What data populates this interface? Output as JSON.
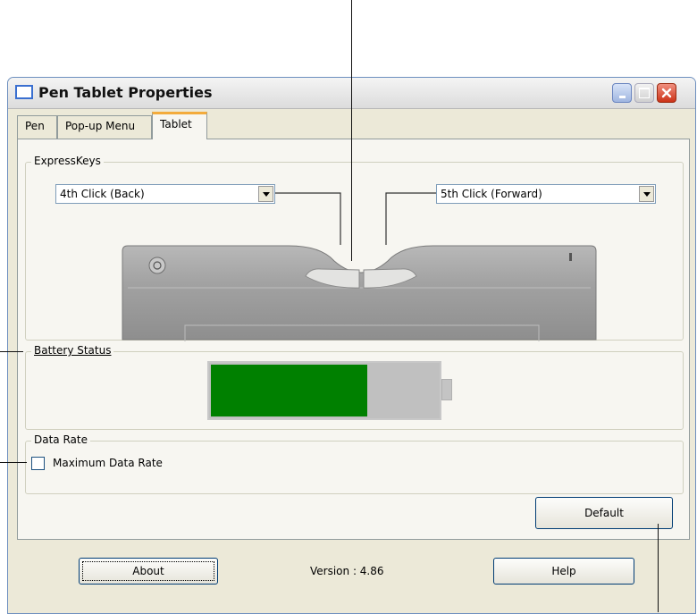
{
  "window": {
    "title": "Pen Tablet Properties",
    "tabs": [
      {
        "label": "Pen"
      },
      {
        "label": "Pop-up Menu"
      },
      {
        "label": "Tablet"
      }
    ],
    "active_tab": "Tablet"
  },
  "express_keys": {
    "legend": "ExpressKeys",
    "left_select": "4th Click (Back)",
    "right_select": "5th Click (Forward)"
  },
  "battery": {
    "legend": "Battery Status",
    "level": 0.68,
    "fill_color": "#008000",
    "empty_color": "#c0c0c0"
  },
  "data_rate": {
    "legend": "Data Rate",
    "checkbox_label": "Maximum Data Rate",
    "checked": false
  },
  "buttons": {
    "default": "Default",
    "about": "About",
    "help": "Help"
  },
  "version": "Version : 4.86",
  "icons": [
    "window-icon",
    "minimize-icon",
    "maximize-icon",
    "close-icon",
    "dropdown-arrow-icon",
    "tablet-power-icon"
  ]
}
